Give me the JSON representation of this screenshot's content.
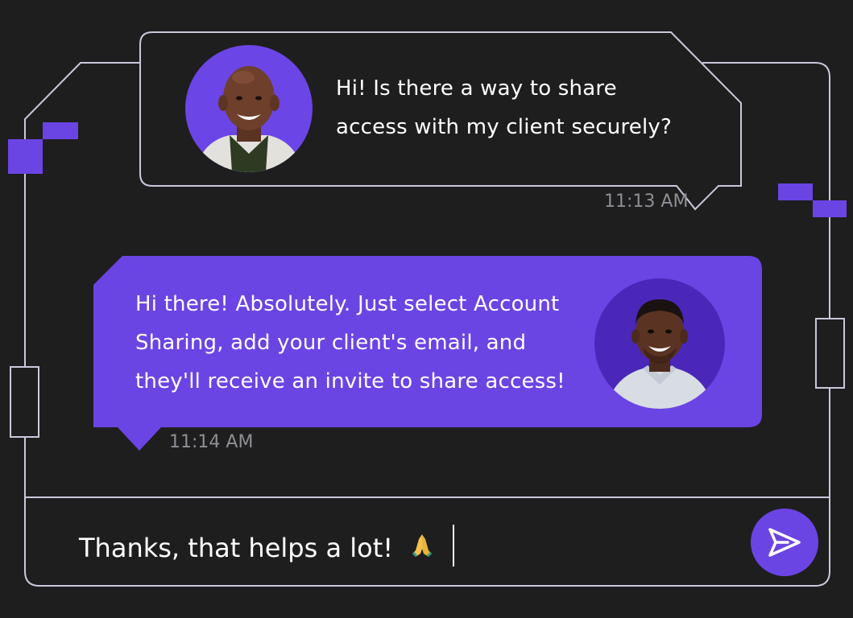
{
  "colors": {
    "background": "#1e1e1e",
    "outline": "#c9c9dc",
    "accent": "#6b44e4",
    "bubble_reply": "#6b44e4",
    "timestamp": "#8e8e96",
    "text": "#ffffff"
  },
  "messages": [
    {
      "sender": "user",
      "lines": [
        "Hi! Is there a way to share",
        "access with my client securely?"
      ],
      "time": "11:13 AM",
      "avatar": "bald-man-photo"
    },
    {
      "sender": "agent",
      "lines": [
        "Hi there! Absolutely. Just select Account",
        "Sharing, add your client's email, and",
        "they'll receive an invite to share access!"
      ],
      "time": "11:14 AM",
      "avatar": "man-light-shirt-photo"
    }
  ],
  "composer": {
    "value": "Thanks, that helps a lot!",
    "emoji_icon": "folded-hands-icon",
    "send_icon": "send-icon"
  }
}
